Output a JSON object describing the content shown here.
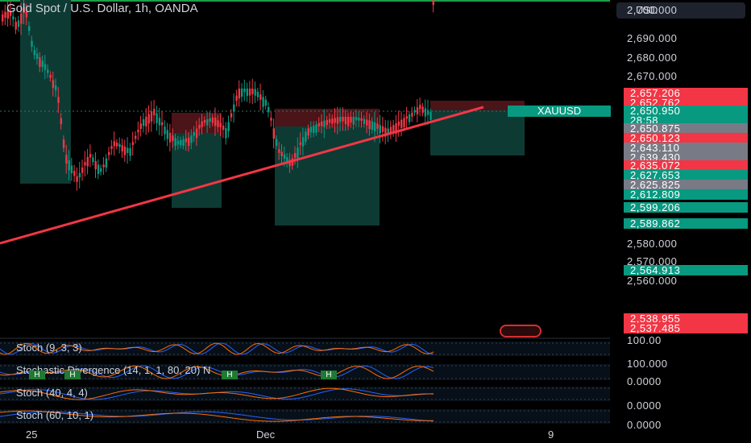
{
  "chart": {
    "title": "Gold Spot / U.S. Dollar, 1h, OANDA",
    "currency": "USD",
    "ticker": "XAUUSD",
    "price_ticks": [
      "2,700.000",
      "2,690.000",
      "2,680.000",
      "2,670.000",
      "2,580.000",
      "2,570.000",
      "2,560.000"
    ],
    "price_tags": [
      {
        "label": "2,657.206",
        "color": "#f23645"
      },
      {
        "label": "2,652.762",
        "color": "#f23645"
      },
      {
        "label": "2,650.950",
        "color": "#089981"
      },
      {
        "label": "28:58",
        "color": "#089981"
      },
      {
        "label": "2,650.875",
        "color": "#787b86"
      },
      {
        "label": "2,650.123",
        "color": "#f23645"
      },
      {
        "label": "2,643.110",
        "color": "#787b86"
      },
      {
        "label": "2,639.430",
        "color": "#787b86"
      },
      {
        "label": "2,635.072",
        "color": "#f23645"
      },
      {
        "label": "2,627.653",
        "color": "#089981"
      },
      {
        "label": "2,625.825",
        "color": "#787b86"
      },
      {
        "label": "2,612.809",
        "color": "#089981"
      },
      {
        "label": "2,599.206",
        "color": "#089981"
      },
      {
        "label": "2,589.862",
        "color": "#089981"
      },
      {
        "label": "2,564.913",
        "color": "#089981"
      },
      {
        "label": "2,538.955",
        "color": "#f23645"
      },
      {
        "label": "2,537.485",
        "color": "#f23645"
      }
    ],
    "x_labels": [
      "25",
      "Dec",
      "9"
    ]
  },
  "indicators": [
    {
      "label": "Stoch (9, 3, 3)",
      "axis": "100.00"
    },
    {
      "label": "Stochastic Divergence (14, 1, 1, 80, 20) N",
      "axis": "100.000"
    },
    {
      "label": "Stoch (40, 4, 4)",
      "axis": "0.0000"
    },
    {
      "label": "Stoch (60, 10, 1)",
      "axis": "0.0000"
    }
  ],
  "extra_axis": [
    "0.0000",
    "0.00"
  ],
  "badges": [
    "H",
    "H",
    "H",
    "H"
  ]
}
